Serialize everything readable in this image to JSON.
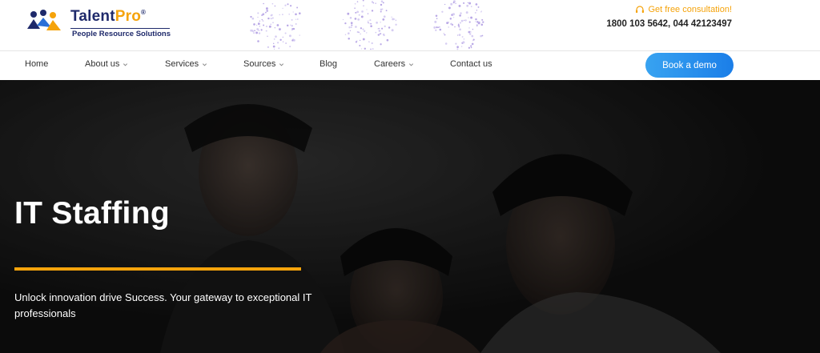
{
  "header": {
    "logo": {
      "name_part1": "Talent",
      "name_part2": "Pro",
      "registered": "®",
      "tagline": "People Resource Solutions"
    },
    "consultation_text": "Get free consultation!",
    "consultation_icon": "headset-icon",
    "phones": "1800 103 5642, 044 42123497"
  },
  "nav": {
    "items": [
      {
        "label": "Home",
        "has_dropdown": false
      },
      {
        "label": "About us",
        "has_dropdown": true
      },
      {
        "label": "Services",
        "has_dropdown": true
      },
      {
        "label": "Sources",
        "has_dropdown": true
      },
      {
        "label": "Blog",
        "has_dropdown": false
      },
      {
        "label": "Careers",
        "has_dropdown": true
      },
      {
        "label": "Contact us",
        "has_dropdown": false
      }
    ],
    "cta_label": "Book a demo"
  },
  "hero": {
    "title": "IT Staffing",
    "subtitle": "Unlock innovation drive Success. Your gateway to exceptional IT professionals"
  },
  "colors": {
    "brand_navy": "#1f2a6b",
    "brand_orange": "#f5a30b",
    "cta_blue": "#2a90ee",
    "hero_bg": "#161616"
  }
}
